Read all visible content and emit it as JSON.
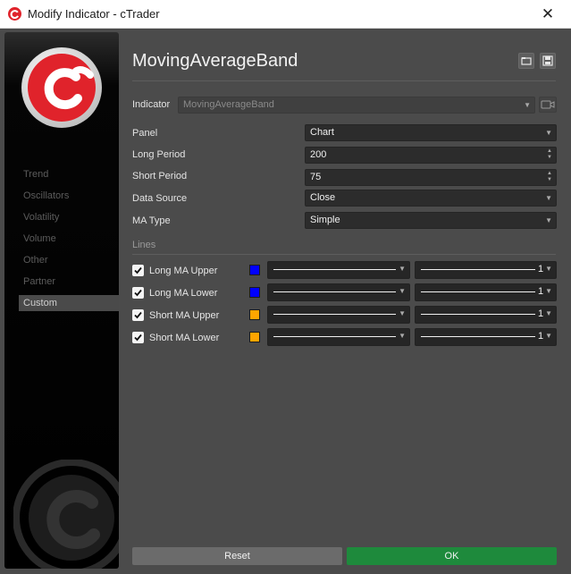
{
  "window": {
    "title": "Modify Indicator - cTrader",
    "close_glyph": "✕"
  },
  "sidebar": {
    "items": [
      {
        "label": "Trend",
        "active": false
      },
      {
        "label": "Oscillators",
        "active": false
      },
      {
        "label": "Volatility",
        "active": false
      },
      {
        "label": "Volume",
        "active": false
      },
      {
        "label": "Other",
        "active": false
      },
      {
        "label": "Partner",
        "active": false
      },
      {
        "label": "Custom",
        "active": true
      }
    ]
  },
  "header": {
    "title": "MovingAverageBand",
    "icons": [
      "load-icon",
      "save-icon"
    ]
  },
  "indicator": {
    "label": "Indicator",
    "value": "MovingAverageBand"
  },
  "params": {
    "panel": {
      "label": "Panel",
      "value": "Chart"
    },
    "long_period": {
      "label": "Long Period",
      "value": "200"
    },
    "short_period": {
      "label": "Short Period",
      "value": "75"
    },
    "data_source": {
      "label": "Data Source",
      "value": "Close"
    },
    "ma_type": {
      "label": "MA Type",
      "value": "Simple"
    }
  },
  "lines": {
    "title": "Lines",
    "items": [
      {
        "label": "Long MA Upper",
        "checked": true,
        "color": "#0000ff",
        "width": "1"
      },
      {
        "label": "Long MA Lower",
        "checked": true,
        "color": "#0000ff",
        "width": "1"
      },
      {
        "label": "Short MA Upper",
        "checked": true,
        "color": "#ffa500",
        "width": "1"
      },
      {
        "label": "Short MA Lower",
        "checked": true,
        "color": "#ffa500",
        "width": "1"
      }
    ]
  },
  "footer": {
    "reset_label": "Reset",
    "ok_label": "OK"
  },
  "colors": {
    "accent_ok": "#1e8a3c",
    "brand_red": "#e0232b"
  }
}
